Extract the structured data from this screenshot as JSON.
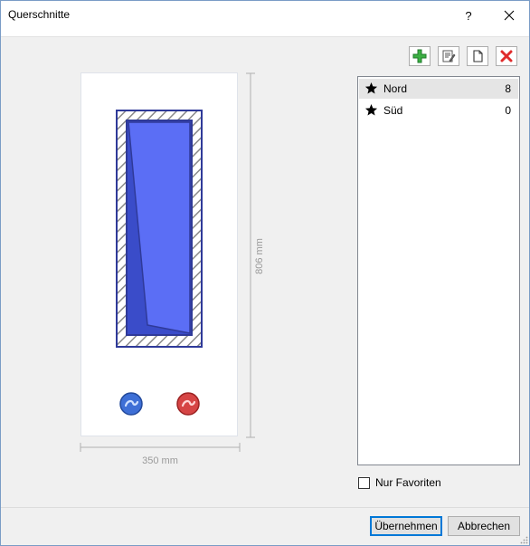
{
  "window": {
    "title": "Querschnitte",
    "help_label": "?"
  },
  "icons": {
    "help": "help-icon",
    "close": "close-icon",
    "add": "add-icon",
    "edit": "edit-icon",
    "copy": "copy-icon",
    "delete": "delete-icon",
    "star": "star-icon",
    "pipe_cold": "cold-pipe-icon",
    "pipe_hot": "hot-pipe-icon"
  },
  "colors": {
    "window_fill": "#5b6ef5",
    "window_frame": "#2f3a99",
    "pipe_cold": "#3e6fd6",
    "pipe_hot": "#d64545",
    "add_green": "#2ea043",
    "delete_red": "#e02b2b"
  },
  "preview": {
    "width_label": "350 mm",
    "height_label": "806 mm"
  },
  "list": {
    "items": [
      {
        "label": "Nord",
        "count": "8",
        "selected": true
      },
      {
        "label": "Süd",
        "count": "0",
        "selected": false
      }
    ]
  },
  "filter": {
    "favorites_label": "Nur Favoriten",
    "checked": false
  },
  "buttons": {
    "apply": "Übernehmen",
    "cancel": "Abbrechen"
  }
}
